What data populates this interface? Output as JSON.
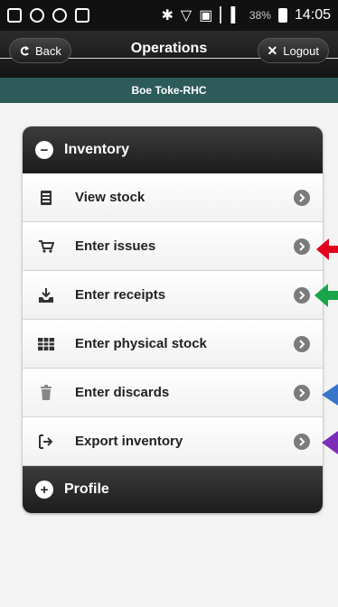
{
  "status_bar": {
    "battery_percent": "38%",
    "time": "14:05"
  },
  "header": {
    "title": "Operations",
    "back_label": "Back",
    "logout_label": "Logout",
    "subtitle": "Boe Toke-RHC"
  },
  "inventory": {
    "title": "Inventory",
    "items": [
      {
        "label": "View stock",
        "icon": "barcode-icon"
      },
      {
        "label": "Enter issues",
        "icon": "cart-icon"
      },
      {
        "label": "Enter receipts",
        "icon": "inbox-icon"
      },
      {
        "label": "Enter physical stock",
        "icon": "grid-icon"
      },
      {
        "label": "Enter discards",
        "icon": "trash-icon"
      },
      {
        "label": "Export inventory",
        "icon": "export-icon"
      }
    ]
  },
  "profile": {
    "title": "Profile"
  },
  "colors": {
    "header_bg": "#1f1f1f",
    "subheader_bg": "#2d5b5a",
    "arrow_red": "#e3001b",
    "arrow_green": "#1aa54a",
    "arrow_blue": "#3a74c8",
    "arrow_purple": "#7b2fb8"
  }
}
